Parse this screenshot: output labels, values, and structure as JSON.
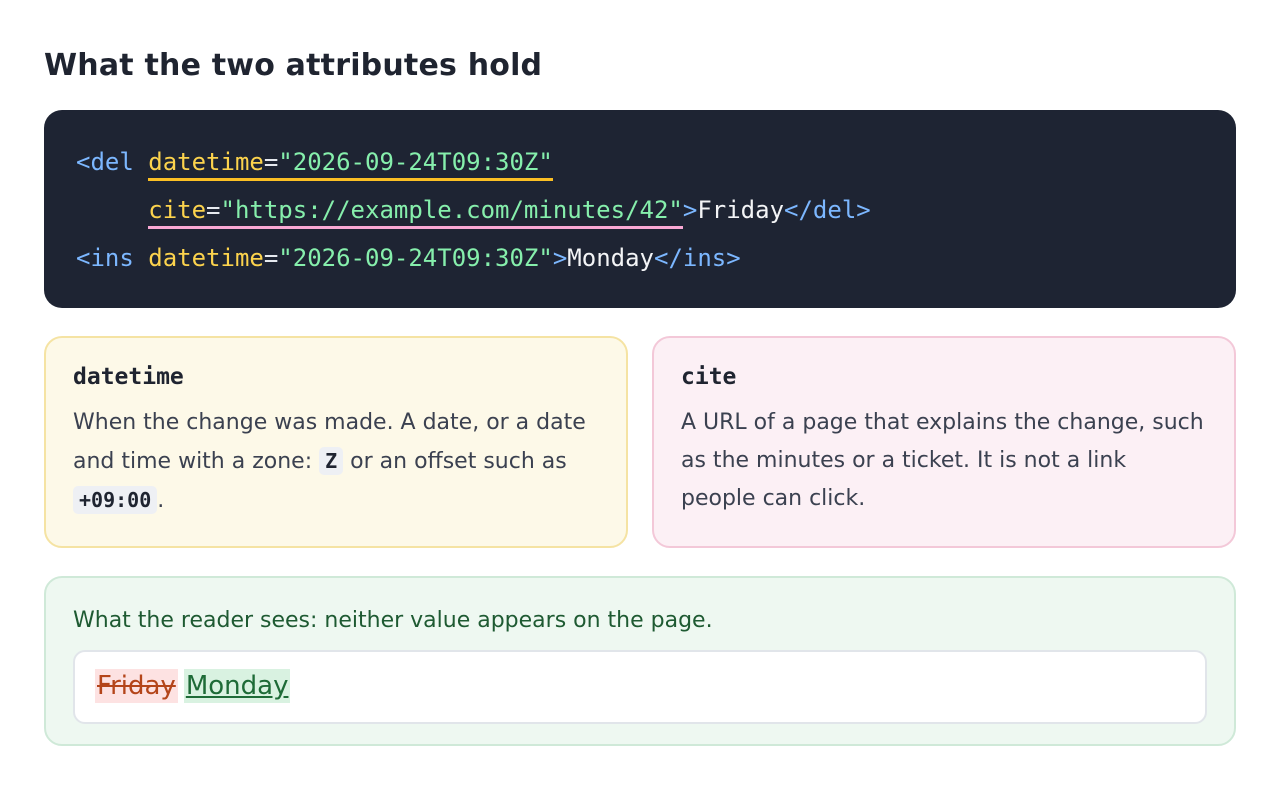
{
  "heading": "What the two attributes hold",
  "code": {
    "line1": {
      "open": "<del ",
      "attr": "datetime",
      "eq": "=",
      "value": "\"2026-09-24T09:30Z\""
    },
    "line2": {
      "indent": "     ",
      "attr": "cite",
      "eq": "=",
      "value": "\"https://example.com/minutes/42\"",
      "close_open": ">",
      "text": "Friday",
      "close_tag": "</del>"
    },
    "line3": {
      "open": "<ins ",
      "attr": "datetime",
      "eq": "=",
      "value": "\"2026-09-24T09:30Z\"",
      "close_open": ">",
      "text": "Monday",
      "close_tag": "</ins>"
    }
  },
  "cards": {
    "datetime": {
      "title": "datetime",
      "text_before": "When the change was made. A date, or a date and time with a zone: ",
      "code1": "Z",
      "text_middle": " or an offset such as ",
      "code2": "+09:00",
      "text_after": "."
    },
    "cite": {
      "title": "cite",
      "text": "A URL of a page that explains the change, such as the minutes or a ticket. It is not a link people can click."
    }
  },
  "reader": {
    "caption": "What the reader sees: neither value appears on the page.",
    "deleted": "Friday",
    "inserted": "Monday"
  },
  "colors": {
    "code_bg": "#1e2433",
    "tag": "#7cb7ff",
    "attr": "#fcd34d",
    "value": "#86efac",
    "datetime_accent": "#fbbf24",
    "cite_accent": "#f9a8d4"
  }
}
